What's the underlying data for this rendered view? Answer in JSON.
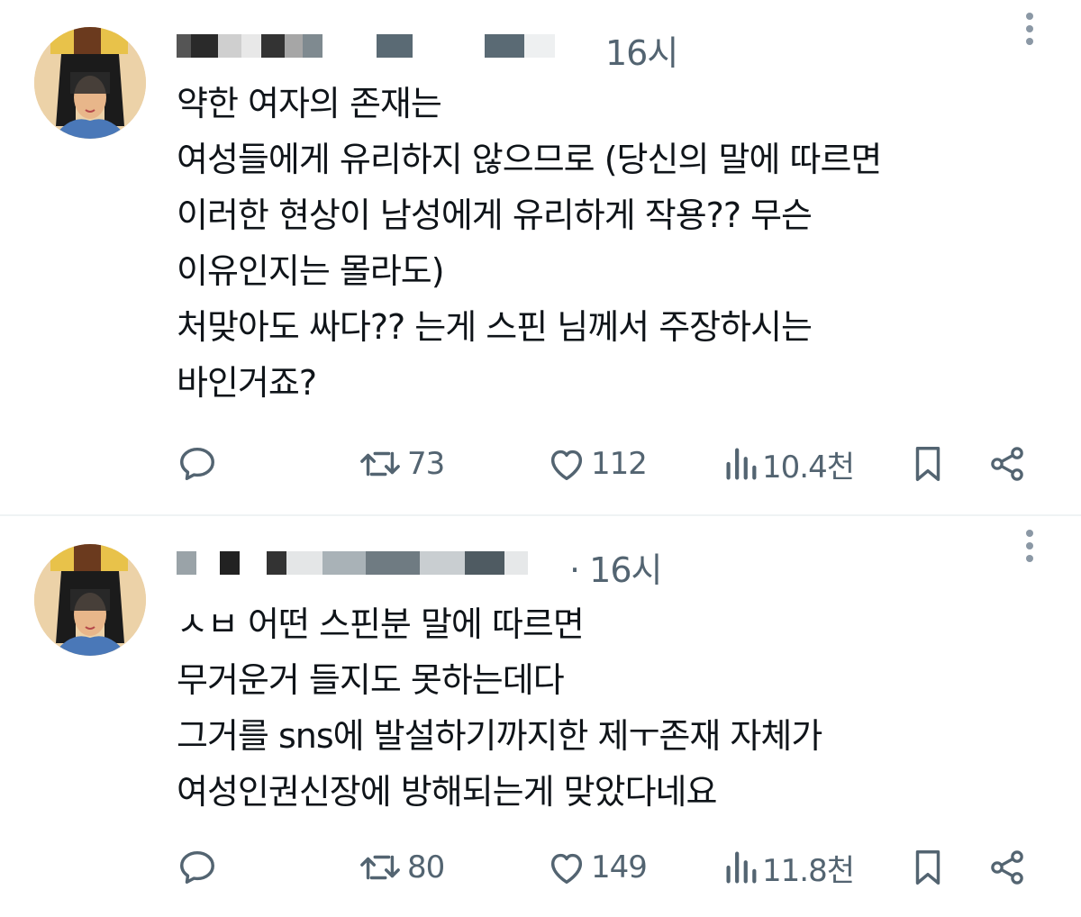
{
  "tweets": [
    {
      "timestamp": "16시",
      "lines": [
        "약한 여자의 존재는",
        "여성들에게 유리하지 않으므로 (당신의 말에 따르면",
        "이러한 현상이 남성에게 유리하게 작용?? 무슨",
        "이유인지는 몰라도)",
        "처맞아도 싸다?? 는게 스핀 님께서 주장하시는",
        "바인거죠?"
      ],
      "retweets": "73",
      "likes": "112",
      "views": "10.4천"
    },
    {
      "timestamp": "· 16시",
      "lines": [
        "ㅅㅂ 어떤 스핀분 말에 따르면",
        "무거운거 들지도 못하는데다",
        "그거를 sns에 발설하기까지한 제ㅜ존재 자체가",
        "여성인권신장에 방해되는게 맞았다네요"
      ],
      "retweets": "80",
      "likes": "149",
      "views": "11.8천"
    }
  ],
  "colors": {
    "text": "#0f1419",
    "muted": "#536471",
    "divider": "#eff3f4"
  },
  "icons": [
    "more-icon",
    "reply-icon",
    "retweet-icon",
    "like-icon",
    "views-icon",
    "bookmark-icon",
    "share-icon"
  ]
}
